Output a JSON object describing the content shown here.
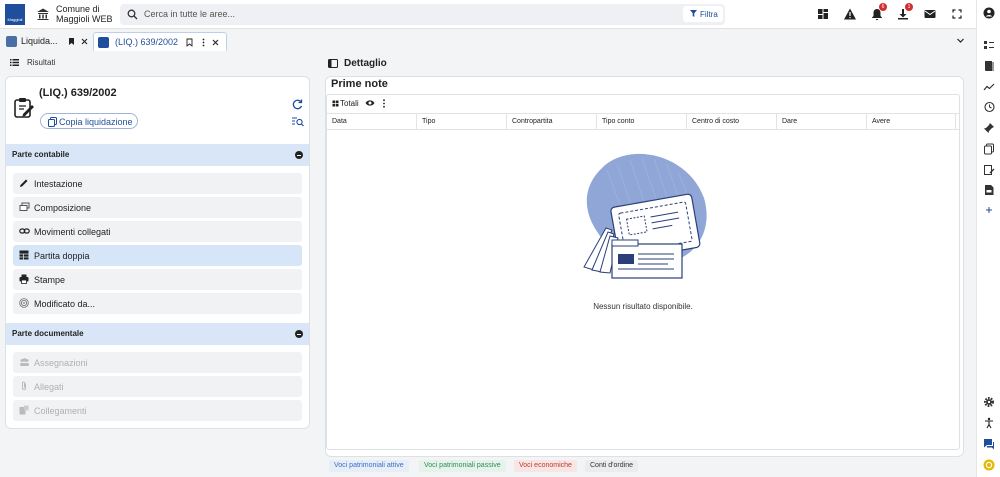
{
  "header": {
    "logo_text": "Maggioli",
    "app_title_line1": "Comune di",
    "app_title_line2": "Maggioli WEB",
    "search_placeholder": "Cerca in tutte le aree...",
    "filter_label": "Filtra",
    "notifications_count": "6",
    "downloads_count": "1"
  },
  "tabs": [
    {
      "label": "Liquida...",
      "active": false
    },
    {
      "label": "(LIQ.) 639/2002",
      "active": true
    }
  ],
  "left": {
    "results_label": "Risultati",
    "record_title": "(LIQ.) 639/2002",
    "copy_label": "Copia liquidazione",
    "section1": "Parte contabile",
    "items1": [
      "Intestazione",
      "Composizione",
      "Movimenti collegati",
      "Partita doppia",
      "Stampe",
      "Modificato da..."
    ],
    "selected_item": "Partita doppia",
    "section2": "Parte documentale",
    "items2": [
      "Assegnazioni",
      "Allegati",
      "Collegamenti"
    ]
  },
  "right": {
    "panel_title": "Dettaglio",
    "grid_title": "Prime note",
    "totali_label": "Totali",
    "columns": [
      "Data",
      "Tipo",
      "Contropartita",
      "Tipo conto",
      "Centro di costo",
      "Dare",
      "Avere"
    ],
    "empty_text": "Nessun risultato disponibile."
  },
  "legend": [
    {
      "label": "Voci patrimoniali attive",
      "color": "#3a6fc4",
      "bg": "#e8eef8"
    },
    {
      "label": "Voci patrimoniali passive",
      "color": "#2e8b57",
      "bg": "#e6f3ea"
    },
    {
      "label": "Voci economiche",
      "color": "#c0392b",
      "bg": "#f8e6e4"
    },
    {
      "label": "Conti d'ordine",
      "color": "#333333",
      "bg": "#ececec"
    }
  ],
  "colors": {
    "accent": "#1f4e9c",
    "section_bg": "#d8e6f7",
    "selected_bg": "#d6e5f8",
    "badge": "#d32f2f"
  },
  "rail_icons": [
    "user-icon",
    "list-icon",
    "book-icon",
    "trend-icon",
    "history-icon",
    "pin-icon",
    "copy-icon",
    "edit-doc-icon",
    "pdf-icon",
    "plus-icon",
    "settings-icon",
    "accessibility-icon",
    "chat-icon",
    "help-icon"
  ]
}
